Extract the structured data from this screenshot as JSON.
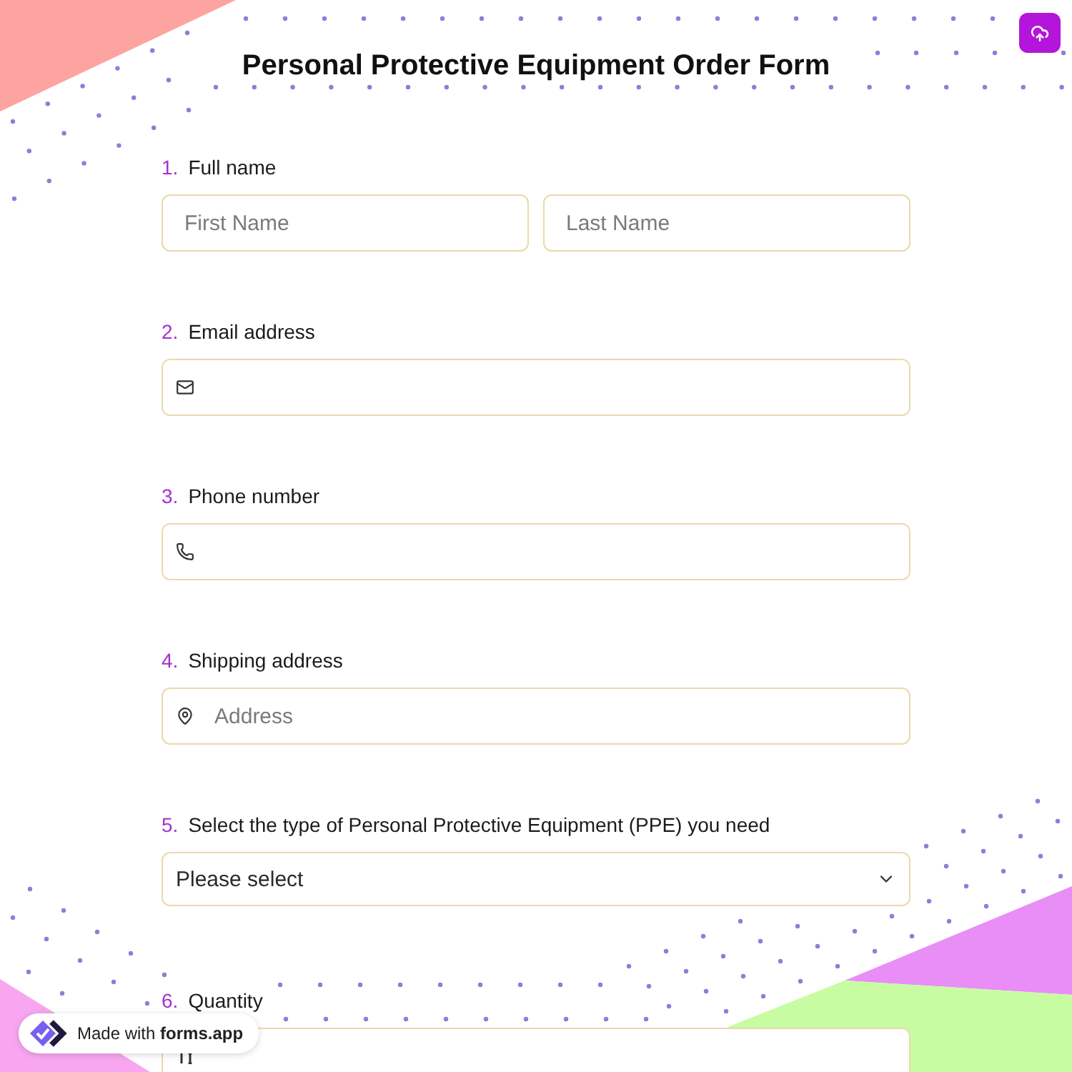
{
  "form": {
    "title": "Personal Protective Equipment Order Form"
  },
  "questions": [
    {
      "number": "1.",
      "label": "Full name",
      "kind": "name",
      "fields": [
        {
          "placeholder": "First Name"
        },
        {
          "placeholder": "Last Name"
        }
      ]
    },
    {
      "number": "2.",
      "label": "Email address",
      "kind": "email"
    },
    {
      "number": "3.",
      "label": "Phone number",
      "kind": "phone"
    },
    {
      "number": "4.",
      "label": "Shipping address",
      "kind": "address",
      "placeholder": "Address"
    },
    {
      "number": "5.",
      "label": "Select the type of Personal Protective Equipment (PPE) you need",
      "kind": "dropdown",
      "placeholder": "Please select"
    },
    {
      "number": "6.",
      "label": "Quantity",
      "kind": "number"
    }
  ],
  "badge": {
    "text": "Made with **forms.app**"
  }
}
